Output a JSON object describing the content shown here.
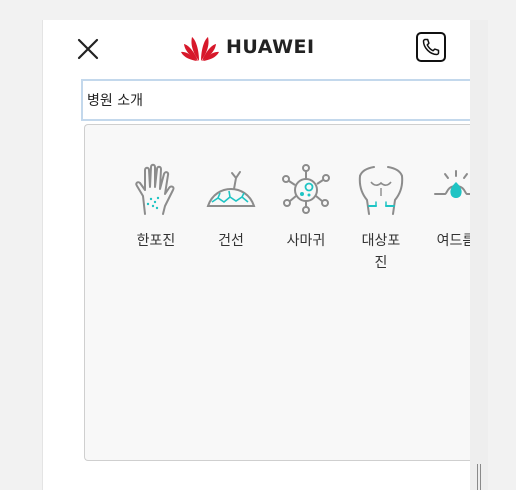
{
  "header": {
    "close_icon": "close-icon",
    "logo_text": "HUAWEI",
    "phone_icon": "phone-icon"
  },
  "search": {
    "value": "병원 소개"
  },
  "categories": [
    {
      "label": "한포진",
      "icon": "hand-icon"
    },
    {
      "label": "건선",
      "icon": "skin-cracks-icon"
    },
    {
      "label": "사마귀",
      "icon": "virus-icon"
    },
    {
      "label": "대상포진",
      "icon": "torso-icon"
    },
    {
      "label": "여드름",
      "icon": "pimple-icon"
    }
  ],
  "colors": {
    "accent": "#1fc4c4",
    "icon_gray": "#8c8c8c",
    "brand_red": "#d7182a"
  }
}
